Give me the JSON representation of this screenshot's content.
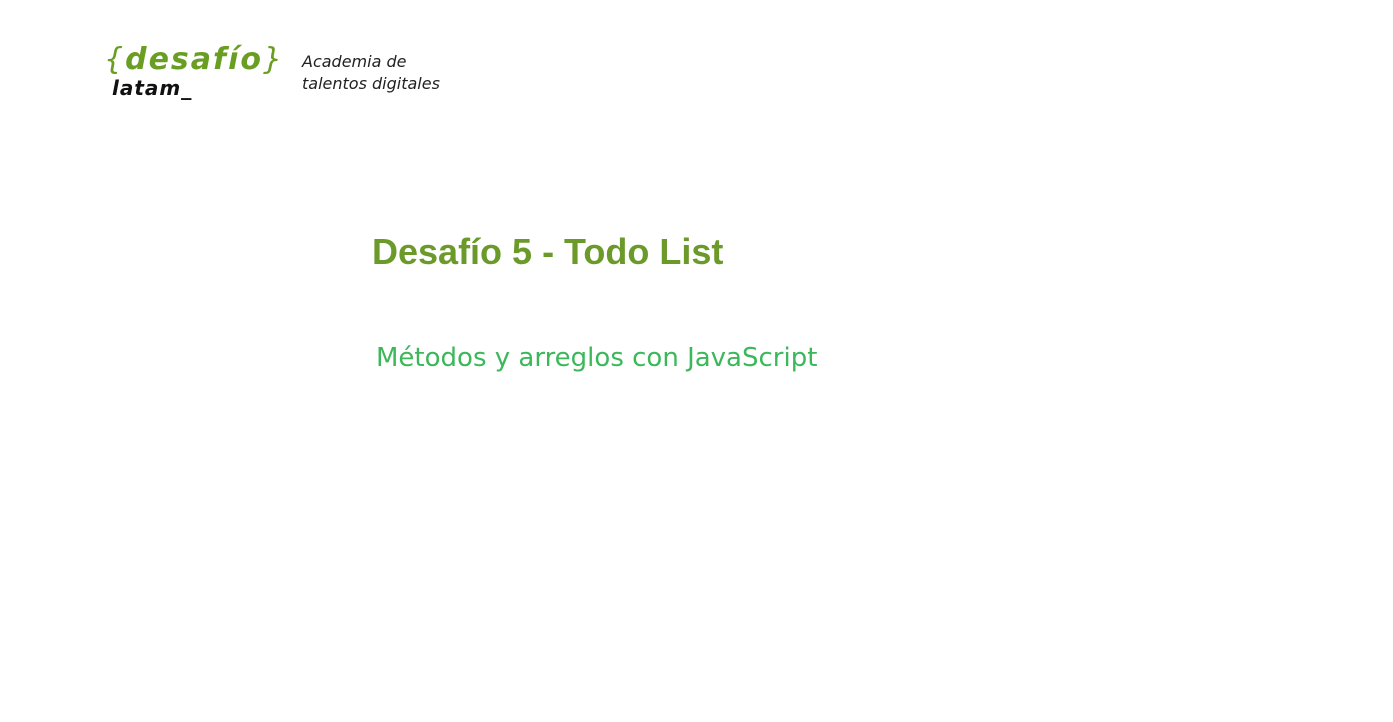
{
  "logo": {
    "brace_open": "{",
    "brand": "desafío",
    "brace_close": "}",
    "sub_brand": "latam_",
    "tagline_line1": "Academia de",
    "tagline_line2": "talentos digitales"
  },
  "slide": {
    "title": "Desafío 5 - Todo List",
    "subtitle": "Métodos y arreglos con JavaScript"
  },
  "colors": {
    "brand_green": "#6a9e22",
    "title_green": "#6b9a2a",
    "subtitle_green": "#3cb85a",
    "background": "#ffffff"
  }
}
